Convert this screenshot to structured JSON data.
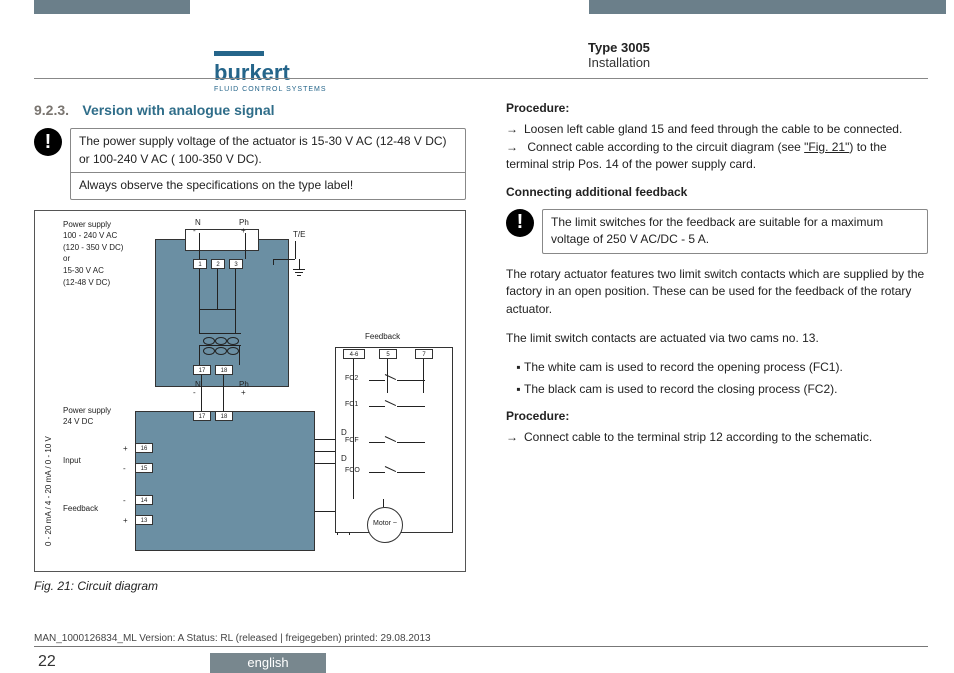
{
  "brand": {
    "name": "burkert",
    "tagline": "FLUID CONTROL SYSTEMS"
  },
  "doc": {
    "type": "Type 3005",
    "section": "Installation"
  },
  "section": {
    "number": "9.2.3.",
    "title": "Version with analogue signal"
  },
  "warning1": {
    "line1": "The power supply voltage of the actuator is 15-30 V AC (12-48 V DC) or 100-240 V AC ( 100-350 V DC).",
    "line2": "Always observe the specifications on the type label!"
  },
  "diagram": {
    "ps1": "Power supply\n100 - 240 V AC\n(120 - 350 V DC)\nor\n15-30 V AC\n(12-48 V DC)",
    "ps2": "Power supply\n24 V DC",
    "input": "Input",
    "feedback_lbl": "Feedback",
    "N": "N",
    "Ph": "Ph",
    "minus": "-",
    "plus": "+",
    "TE": "T/E",
    "terms_top": [
      "1",
      "2",
      "3"
    ],
    "terms_mid": [
      "17",
      "18"
    ],
    "terms_mid2": [
      "17",
      "18"
    ],
    "terms_io": [
      "16",
      "15",
      "14",
      "13"
    ],
    "terms_fb": [
      "4-6",
      "5",
      "7"
    ],
    "D": "D",
    "fc": [
      "FC2",
      "FC1",
      "FCF",
      "FCO"
    ],
    "motor": "Motor\n~",
    "vert": "0 - 20 mA / 4 - 20 mA / 0 - 10 V"
  },
  "fig_caption": "Fig. 21:    Circuit diagram",
  "right": {
    "procedure": "Procedure:",
    "p1": "Loosen left cable gland 15 and feed through the cable to be connected.",
    "p2a": "Connect cable according to the circuit diagram (see ",
    "p2b": "\"Fig. 21\"",
    "p2c": ") to the terminal strip Pos. 14 of the power supply card.",
    "conn_add_fb": "Connecting additional feedback",
    "warn2": "The limit switches for the feedback are suitable for a maximum voltage of 250 V AC/DC - 5 A.",
    "para1": "The rotary actuator features two limit switch contacts which are supplied by the factory in an open position. These can be used for the feedback of the rotary actuator.",
    "para2": "The limit switch contacts are actuated via two cams no. 13.",
    "b1": "The white cam is used to record the opening process (FC1).",
    "b2": "The black cam is used to record the closing process (FC2).",
    "procedure2": "Procedure:",
    "p3": "Connect cable to the terminal strip 12 according to the schematic."
  },
  "footer": {
    "meta": "MAN_1000126834_ML  Version: A Status: RL (released | freigegeben)  printed: 29.08.2013",
    "page": "22",
    "lang": "english"
  }
}
